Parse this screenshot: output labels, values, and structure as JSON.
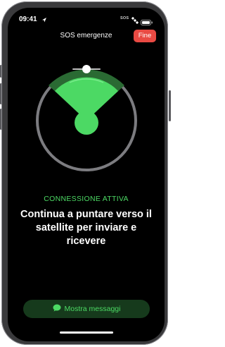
{
  "status_bar": {
    "time": "09:41",
    "signal_text": "SOS",
    "icons": [
      "location-arrow-icon",
      "satellite-icon",
      "battery-icon"
    ]
  },
  "header": {
    "title": "SOS emergenze",
    "end_label": "Fine"
  },
  "connection": {
    "status": "CONNESSIONE ATTIVA",
    "instruction": "Continua a puntare verso il satellite per inviare e ricevere"
  },
  "messages_button": {
    "label": "Mostra messaggi",
    "icon": "speech-bubble-icon"
  },
  "colors": {
    "accent_green": "#4cd964",
    "end_red": "#e94a43",
    "background": "#000000"
  }
}
